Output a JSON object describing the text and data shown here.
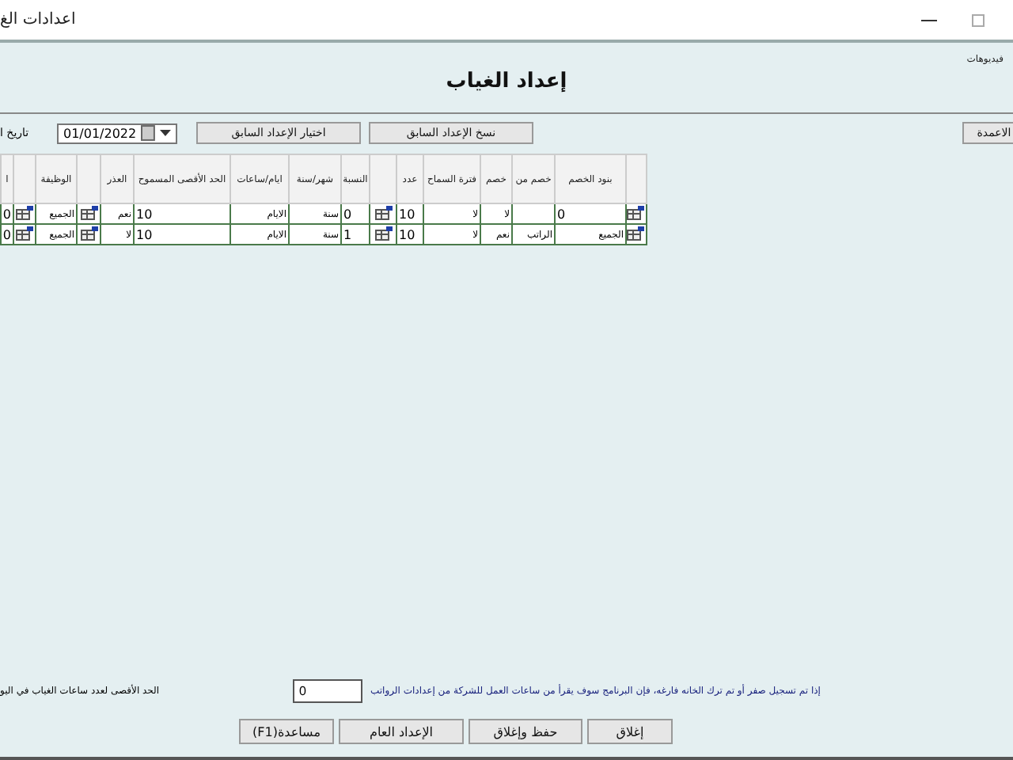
{
  "window": {
    "title": "اعدادات الغ"
  },
  "header": {
    "caption": "فيديوهات",
    "title": "إعداد الغياب"
  },
  "toolbar": {
    "date_label": "تاريخ ا",
    "date": "01/01/2022",
    "buttons": [
      "نسخ الإعداد السابق",
      "اختيار الإعداد السابق"
    ],
    "columns_button": "الاعمدة"
  },
  "table": {
    "columns": [
      {
        "kind": "icon"
      },
      {
        "kind": "text",
        "label": "بنود الخصم"
      },
      {
        "kind": "text",
        "label": "خصم من"
      },
      {
        "kind": "text",
        "label": "خصم"
      },
      {
        "kind": "text",
        "label": "فترة السماح"
      },
      {
        "kind": "text",
        "label": "عدد"
      },
      {
        "kind": "icon"
      },
      {
        "kind": "text",
        "label": "النسبة"
      },
      {
        "kind": "text",
        "label": "شهر/سنة"
      },
      {
        "kind": "text",
        "label": "ايام/ساعات"
      },
      {
        "kind": "text",
        "label": "الحد الأقصى المسموح"
      },
      {
        "kind": "text",
        "label": "العذر"
      },
      {
        "kind": "icon"
      },
      {
        "kind": "text",
        "label": "الوظيفة"
      },
      {
        "kind": "icon"
      },
      {
        "kind": "text",
        "label": "ا"
      }
    ],
    "rows": [
      {
        "cells": [
          {
            "kind": "icon"
          },
          {
            "kind": "number",
            "text": "0"
          },
          {
            "kind": "text"
          },
          {
            "kind": "text",
            "text": "لا"
          },
          {
            "kind": "text",
            "text": "لا"
          },
          {
            "kind": "number",
            "text": "10"
          },
          {
            "kind": "icon"
          },
          {
            "kind": "number",
            "text": "0"
          },
          {
            "kind": "text",
            "text": "سنة"
          },
          {
            "kind": "text",
            "text": "الايام"
          },
          {
            "kind": "number",
            "text": "10"
          },
          {
            "kind": "text",
            "text": "نعم"
          },
          {
            "kind": "icon"
          },
          {
            "kind": "text",
            "text": "الجميع"
          },
          {
            "kind": "icon"
          },
          {
            "kind": "number",
            "text": "0"
          }
        ]
      },
      {
        "cells": [
          {
            "kind": "icon"
          },
          {
            "kind": "text",
            "text": "الجميع"
          },
          {
            "kind": "text",
            "text": "الراتب"
          },
          {
            "kind": "text",
            "text": "نعم"
          },
          {
            "kind": "text",
            "text": "لا"
          },
          {
            "kind": "number",
            "text": "10"
          },
          {
            "kind": "icon"
          },
          {
            "kind": "number",
            "text": "1"
          },
          {
            "kind": "text",
            "text": "سنة"
          },
          {
            "kind": "text",
            "text": "الايام"
          },
          {
            "kind": "number",
            "text": "10"
          },
          {
            "kind": "text",
            "text": "لا"
          },
          {
            "kind": "icon"
          },
          {
            "kind": "text",
            "text": "الجميع"
          },
          {
            "kind": "icon"
          },
          {
            "kind": "number",
            "text": "0"
          }
        ]
      }
    ]
  },
  "footer": {
    "max_label": "الحد الأقصى لعدد ساعات الغياب في اليو",
    "max_value": "0",
    "note": "إذا تم تسجيل صفر أو تم ترك الخانه فارغه، فإن البرنامج سوف يقرأ من ساعات العمل للشركة من إعدادات الرواتب"
  },
  "buttons": [
    "إغلاق",
    "حفظ وإغلاق",
    "الإعداد العام",
    "(F1)مساعدة"
  ]
}
